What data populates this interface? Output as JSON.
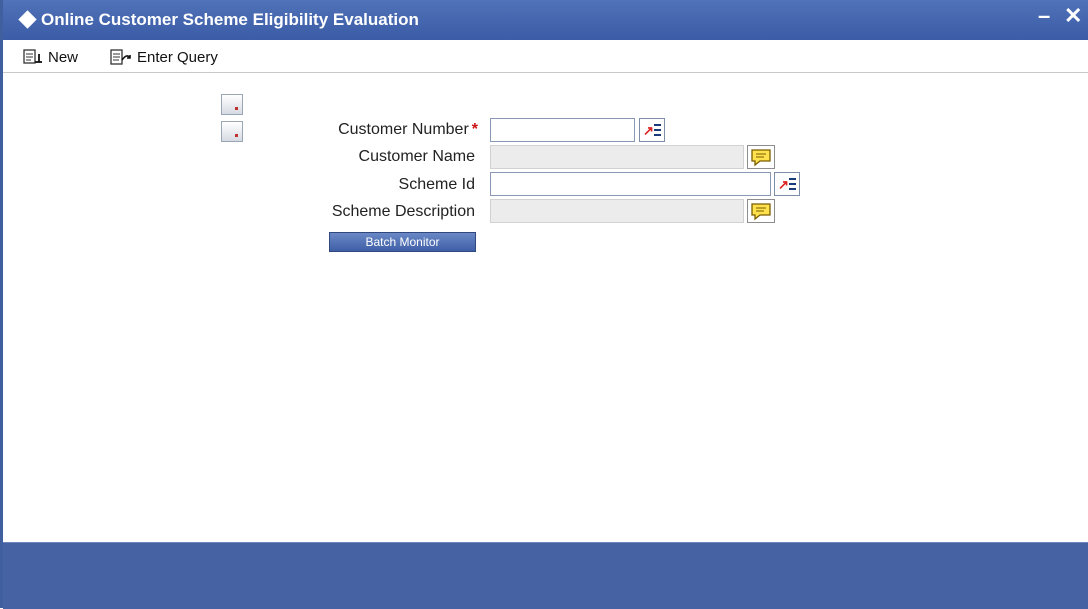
{
  "window": {
    "title": "Online Customer Scheme Eligibility Evaluation",
    "minimize_glyph": "–",
    "close_glyph": "✕"
  },
  "toolbar": {
    "new_label": "New",
    "enter_query_label": "Enter Query"
  },
  "form": {
    "customer_number": {
      "label": "Customer Number",
      "required_mark": "*",
      "value": ""
    },
    "customer_name": {
      "label": "Customer Name",
      "value": ""
    },
    "scheme_id": {
      "label": "Scheme Id",
      "value": ""
    },
    "scheme_description": {
      "label": "Scheme Description",
      "value": ""
    },
    "batch_monitor_label": "Batch Monitor"
  },
  "icons": {
    "title": "diamond-icon",
    "new": "new-document-icon",
    "enter_query": "enter-query-icon",
    "lov": "list-of-values-icon",
    "description": "speech-bubble-icon",
    "side": "document-icon"
  },
  "colors": {
    "title_bar": "#3b5ca6",
    "footer": "#4662a3",
    "button": "#4a68ad",
    "required": "#cc1111"
  }
}
